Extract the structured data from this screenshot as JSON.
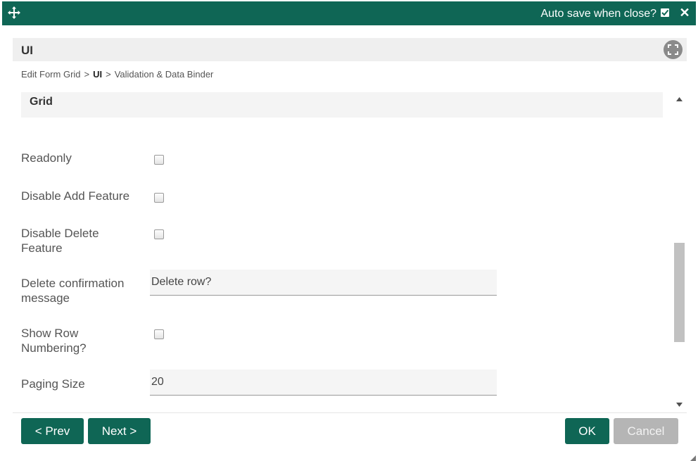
{
  "topbar": {
    "move_icon": "move-arrows-icon",
    "autosave_label": "Auto save when close?",
    "autosave_checked": true,
    "close_icon": "close-icon",
    "bg_color": "#0f6655"
  },
  "header": {
    "title": "UI",
    "fullscreen_icon": "fullscreen-icon"
  },
  "breadcrumb": {
    "items": [
      "Edit Form Grid",
      "UI",
      "Validation & Data Binder"
    ],
    "separator": ">"
  },
  "section": {
    "title": "Grid"
  },
  "fields": {
    "readonly": {
      "label": "Readonly",
      "checked": false
    },
    "disable_add": {
      "label": "Disable Add Feature",
      "checked": false
    },
    "disable_delete": {
      "label": "Disable Delete Feature",
      "checked": false
    },
    "delete_confirmation": {
      "label": "Delete confirmation message",
      "value": "Delete row?"
    },
    "show_row_numbering": {
      "label": "Show Row Numbering?",
      "checked": false
    },
    "paging_size": {
      "label": "Paging Size",
      "value": "20"
    }
  },
  "footer": {
    "prev_label": "< Prev",
    "next_label": "Next >",
    "ok_label": "OK",
    "cancel_label": "Cancel",
    "cancel_disabled": true
  }
}
